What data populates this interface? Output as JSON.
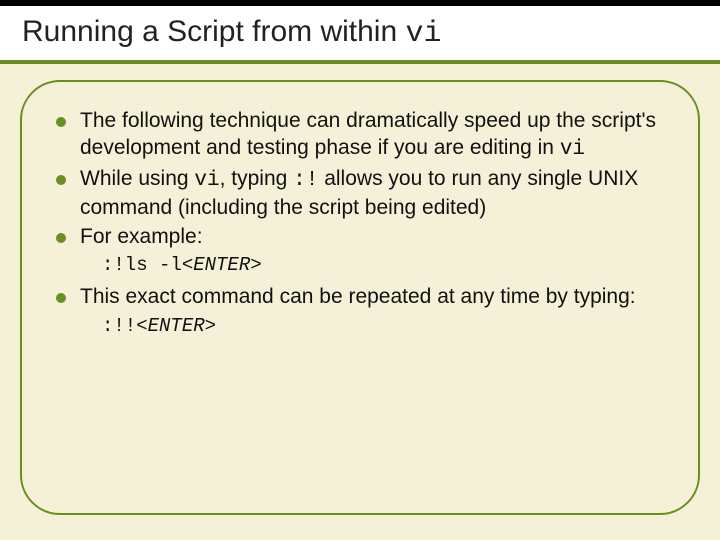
{
  "title": {
    "pre": "Running a Script from within ",
    "mono": "vi"
  },
  "bullets": [
    {
      "parts": [
        {
          "t": "The following technique can dramatically speed up the script's development and testing phase if you are editing in "
        },
        {
          "t": "vi",
          "mono": true
        }
      ]
    },
    {
      "parts": [
        {
          "t": "While using "
        },
        {
          "t": "vi",
          "mono": true
        },
        {
          "t": ", typing  "
        },
        {
          "t": ":!",
          "mono": true
        },
        {
          "t": "  allows you to run any single UNIX command (including the script being edited)"
        }
      ]
    },
    {
      "parts": [
        {
          "t": "For example:"
        }
      ],
      "sub": {
        "cmd": ":!ls -l",
        "enter": "<ENTER>"
      }
    },
    {
      "parts": [
        {
          "t": "This exact command can be repeated at any time by typing:"
        }
      ],
      "sub": {
        "cmd": ":!!",
        "enter": "<ENTER>"
      }
    }
  ]
}
